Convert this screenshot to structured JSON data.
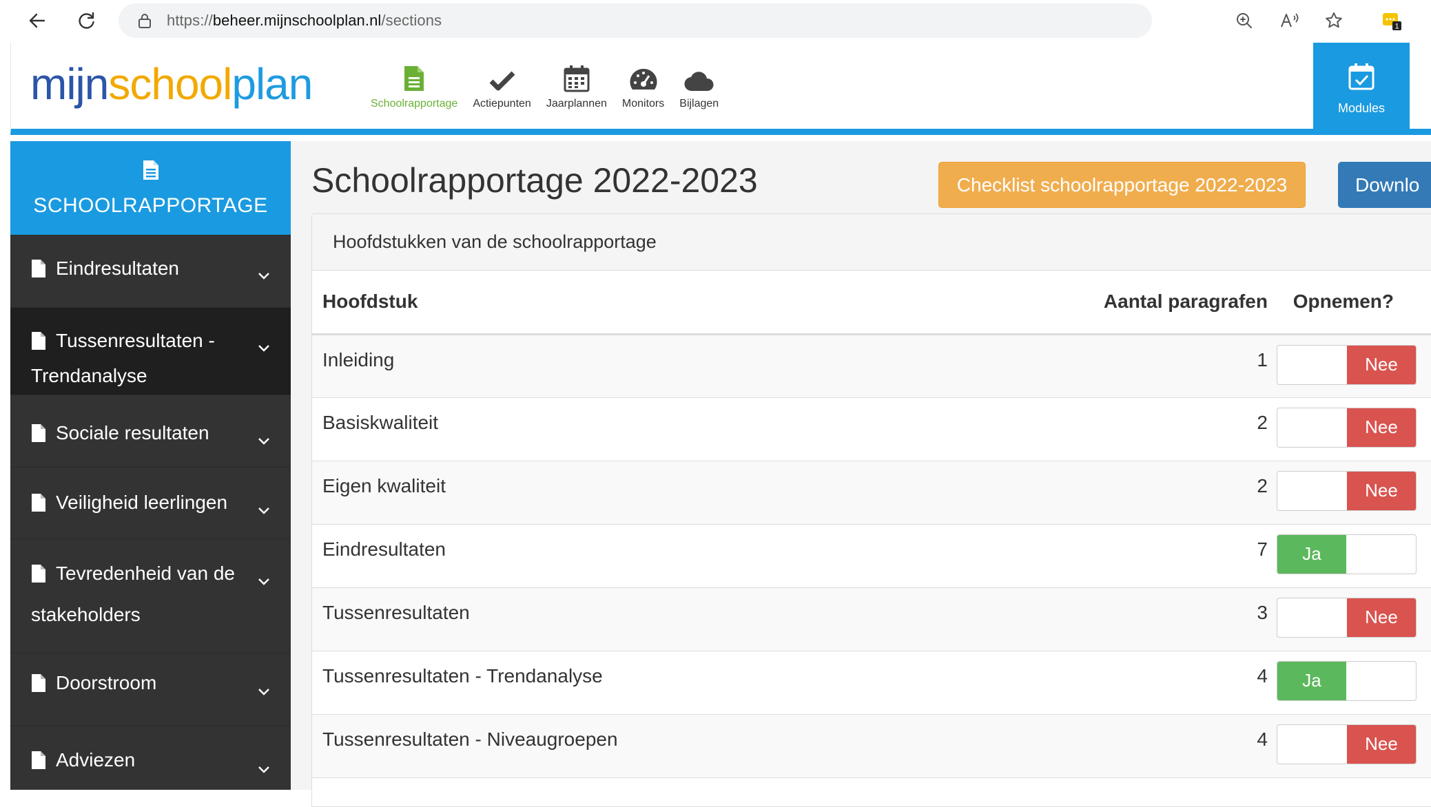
{
  "browser": {
    "url_prefix": "https://",
    "url_host": "beheer.mijnschoolplan.nl",
    "url_path": "/sections"
  },
  "logo": {
    "part1": "mijn",
    "part2": "school",
    "part3": "plan"
  },
  "topnav": [
    {
      "label": "Schoolrapportage",
      "icon": "document-icon",
      "active": true
    },
    {
      "label": "Actiepunten",
      "icon": "check-icon"
    },
    {
      "label": "Jaarplannen",
      "icon": "calendar-icon"
    },
    {
      "label": "Monitors",
      "icon": "dashboard-icon"
    },
    {
      "label": "Bijlagen",
      "icon": "cloud-icon"
    }
  ],
  "modules": {
    "label": "Modules",
    "icon": "calendar-check-icon"
  },
  "header_extra": "V",
  "sidebar": {
    "title": "SCHOOLRAPPORTAGE",
    "items": [
      {
        "line1": "Eindresultaten",
        "line2": ""
      },
      {
        "line1": "Tussenresultaten -",
        "line2": "Trendanalyse",
        "active": true
      },
      {
        "line1": "Sociale resultaten",
        "line2": ""
      },
      {
        "line1": "Veiligheid leerlingen",
        "line2": ""
      },
      {
        "line1": "Tevredenheid van de",
        "line2": "stakeholders"
      },
      {
        "line1": "Doorstroom",
        "line2": ""
      },
      {
        "line1": "Adviezen",
        "line2": ""
      }
    ]
  },
  "main": {
    "title": "Schoolrapportage 2022-2023",
    "checklist_button": "Checklist schoolrapportage 2022-2023",
    "download_button": "Downlo",
    "panel_heading": "Hoofdstukken van de schoolrapportage",
    "columns": {
      "name": "Hoofdstuk",
      "count": "Aantal paragrafen",
      "include": "Opnemen?"
    },
    "rows": [
      {
        "name": "Inleiding",
        "count": "1",
        "include": "Nee"
      },
      {
        "name": "Basiskwaliteit",
        "count": "2",
        "include": "Nee"
      },
      {
        "name": "Eigen kwaliteit",
        "count": "2",
        "include": "Nee"
      },
      {
        "name": "Eindresultaten",
        "count": "7",
        "include": "Ja"
      },
      {
        "name": "Tussenresultaten",
        "count": "3",
        "include": "Nee"
      },
      {
        "name": "Tussenresultaten - Trendanalyse",
        "count": "4",
        "include": "Ja"
      },
      {
        "name": "Tussenresultaten - Niveaugroepen",
        "count": "4",
        "include": "Nee"
      }
    ]
  },
  "colors": {
    "brand_blue": "#1a9ae0",
    "sidebar_dark": "#333333",
    "warning_orange": "#f0ad4e",
    "primary_blue": "#337ab7",
    "danger_red": "#d9534f",
    "success_green": "#5cb85c"
  }
}
